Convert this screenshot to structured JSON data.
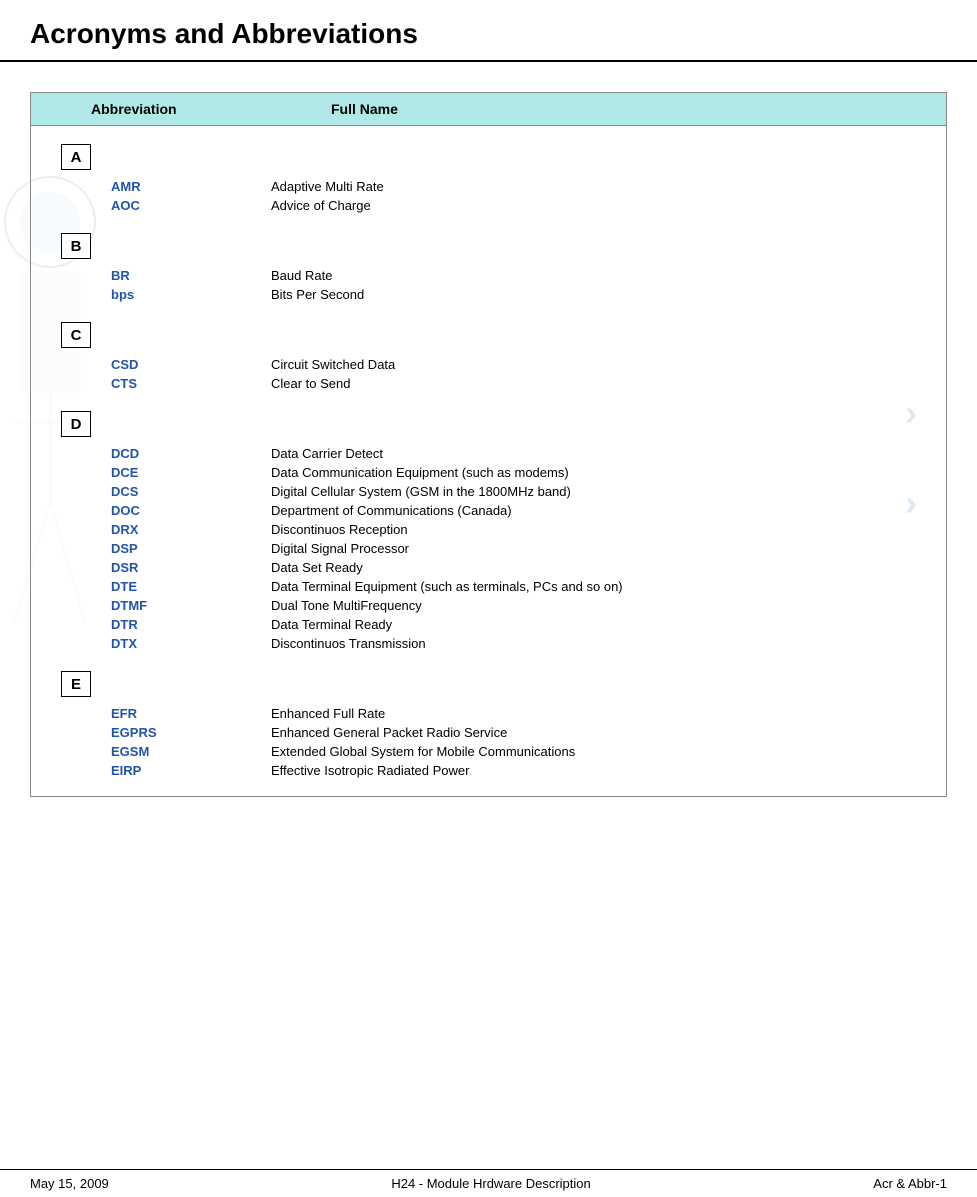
{
  "page": {
    "title": "Acronyms and Abbreviations"
  },
  "table": {
    "header": {
      "abbr_col": "Abbreviation",
      "fullname_col": "Full Name"
    }
  },
  "sections": [
    {
      "letter": "A",
      "entries": [
        {
          "abbr": "AMR",
          "fullname": "Adaptive Multi Rate"
        },
        {
          "abbr": "AOC",
          "fullname": "Advice of Charge"
        }
      ]
    },
    {
      "letter": "B",
      "entries": [
        {
          "abbr": "BR",
          "fullname": "Baud Rate"
        },
        {
          "abbr": "bps",
          "fullname": "Bits Per Second"
        }
      ]
    },
    {
      "letter": "C",
      "entries": [
        {
          "abbr": "CSD",
          "fullname": "Circuit Switched Data"
        },
        {
          "abbr": "CTS",
          "fullname": "Clear to Send"
        }
      ]
    },
    {
      "letter": "D",
      "entries": [
        {
          "abbr": "DCD",
          "fullname": "Data Carrier Detect"
        },
        {
          "abbr": "DCE",
          "fullname": "Data Communication Equipment (such as modems)"
        },
        {
          "abbr": "DCS",
          "fullname": "Digital Cellular System (GSM in the 1800MHz band)"
        },
        {
          "abbr": "DOC",
          "fullname": "Department of Communications (Canada)"
        },
        {
          "abbr": "DRX",
          "fullname": "Discontinuos Reception"
        },
        {
          "abbr": "DSP",
          "fullname": "Digital Signal Processor"
        },
        {
          "abbr": "DSR",
          "fullname": "Data Set Ready"
        },
        {
          "abbr": "DTE",
          "fullname": "Data Terminal Equipment (such as terminals, PCs and so on)"
        },
        {
          "abbr": "DTMF",
          "fullname": "Dual Tone MultiFrequency"
        },
        {
          "abbr": "DTR",
          "fullname": "Data Terminal Ready"
        },
        {
          "abbr": "DTX",
          "fullname": "Discontinuos Transmission"
        }
      ]
    },
    {
      "letter": "E",
      "entries": [
        {
          "abbr": "EFR",
          "fullname": "Enhanced Full Rate"
        },
        {
          "abbr": "EGPRS",
          "fullname": "Enhanced General Packet Radio Service"
        },
        {
          "abbr": "EGSM",
          "fullname": "Extended Global System for Mobile Communications"
        },
        {
          "abbr": "EIRP",
          "fullname": "Effective Isotropic Radiated Power"
        }
      ]
    }
  ],
  "footer": {
    "left": "May 15, 2009",
    "center": "H24 - Module Hrdware Description",
    "right": "Acr & Abbr-1"
  }
}
